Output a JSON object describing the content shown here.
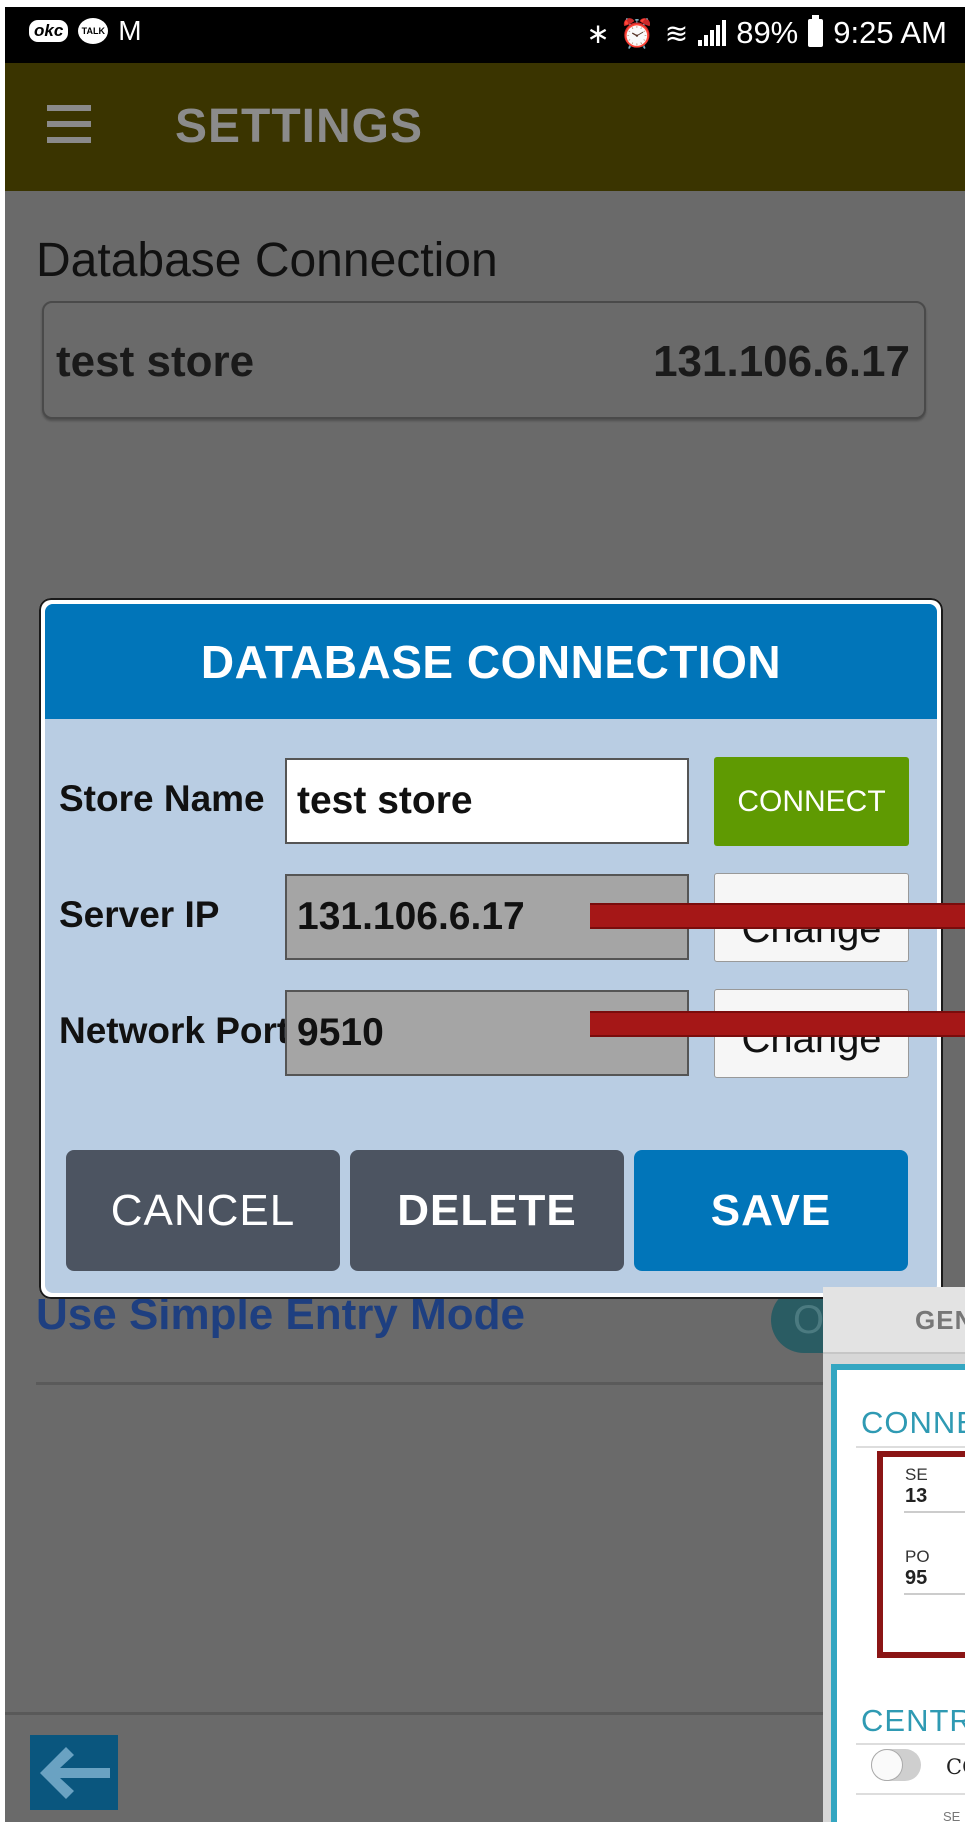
{
  "status_bar": {
    "okc_badge": "okc",
    "talk_badge": "TALK",
    "gmail_glyph": "M",
    "bluetooth_glyph": "∗",
    "alarm_glyph": "⏰",
    "wifi_glyph": "≋",
    "battery_percent": "89%",
    "time": "9:25 AM",
    "icons": [
      "okcupid-icon",
      "kakaotalk-icon",
      "gmail-icon",
      "bluetooth-icon",
      "alarm-icon",
      "wifi-icon",
      "signal-icon",
      "battery-icon"
    ]
  },
  "app_bar": {
    "title": "SETTINGS",
    "menu_icon": "hamburger-menu-icon",
    "background": "#3a3400"
  },
  "settings": {
    "section_title": "Database Connection",
    "connection_card": {
      "name": "test store",
      "ip": "131.106.6.17"
    },
    "simple_entry_label": "Use Simple Entry Mode",
    "simple_entry_toggle_text": "O"
  },
  "dialog": {
    "title": "DATABASE CONNECTION",
    "store_name_label": "Store Name",
    "store_name_value": "test store",
    "connect_label": "CONNECT",
    "server_ip_label": "Server IP",
    "server_ip_value": "131.106.6.17",
    "server_change_label": "Change",
    "network_port_label": "Network Port",
    "network_port_value": "9510",
    "port_change_label": "Change",
    "cancel_label": "CANCEL",
    "delete_label": "DELETE",
    "save_label": "SAVE",
    "colors": {
      "header": "#0175b9",
      "connect": "#5f9a02",
      "save": "#0175b9",
      "neutral": "#4c5461",
      "annotation_arrow": "#a51717"
    }
  },
  "overlay_fragment": {
    "tab_label": "GEN",
    "connect_heading": "CONNE",
    "server_label": "SE",
    "server_value": "13",
    "port_label": "PO",
    "port_value": "95",
    "central_heading": "CENTR",
    "central_toggle_label": "CO",
    "sub_label": "SE"
  },
  "footer": {
    "back_icon": "back-arrow-icon"
  }
}
